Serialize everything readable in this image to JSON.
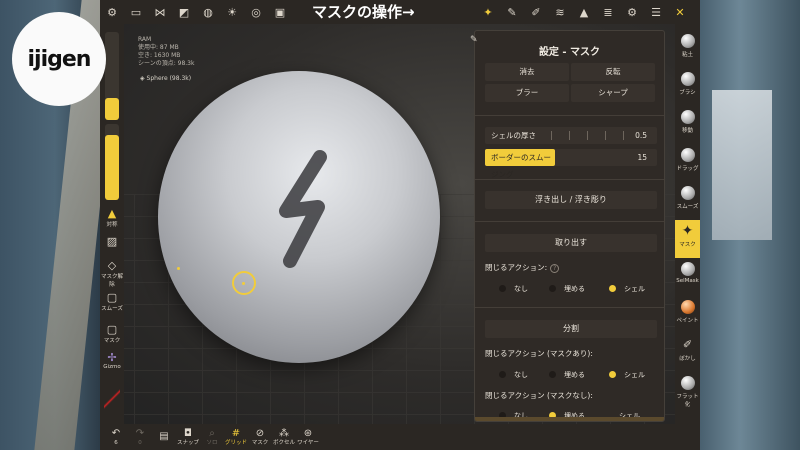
{
  "overlay": {
    "logo_text": "ijigen",
    "title": "マスクの操作→"
  },
  "viewport": {
    "stats": [
      "RAM",
      "使用中: 87 MB",
      "空き: 1630 MB",
      "シーンの頂点: 98.3k"
    ],
    "object_tag": "Sphere (98.3k)"
  },
  "top_toolbar": {
    "left_icons": [
      "scene-icon",
      "folder-icon",
      "share-icon",
      "shapes-icon",
      "globe-icon",
      "sun-icon",
      "material-icon",
      "image-icon"
    ],
    "right_icons": [
      "mask-tool-icon",
      "pen-icon",
      "paint-icon",
      "stroke-icon",
      "triangle-icon",
      "layers-icon",
      "settings-icon",
      "sliders-icon",
      "tools-icon"
    ]
  },
  "left_rail": {
    "tools": [
      {
        "label": "対称",
        "icon": "symmetry-icon"
      },
      {
        "label": "",
        "icon": "image-tool-icon"
      },
      {
        "label": "マスク解除",
        "icon": "eraser-icon"
      },
      {
        "label": "スムーズ",
        "icon": "smooth-icon"
      },
      {
        "label": "マスク",
        "icon": "mask-icon"
      },
      {
        "label": "Gizmo",
        "icon": "gizmo-icon"
      }
    ],
    "size_slider": 0.25,
    "intensity_slider": 0.85
  },
  "bottom_bar": {
    "items": [
      {
        "label": "6",
        "icon": "undo-icon",
        "state": "normal"
      },
      {
        "label": "0",
        "icon": "redo-icon",
        "state": "dim"
      },
      {
        "label": "",
        "icon": "stack-icon",
        "state": "normal"
      },
      {
        "label": "スナップ",
        "icon": "camera-icon",
        "state": "normal"
      },
      {
        "label": "ソロ",
        "icon": "search-icon",
        "state": "dim"
      },
      {
        "label": "グリッド",
        "icon": "grid-icon",
        "state": "active"
      },
      {
        "label": "マスク",
        "icon": "eye-off-icon",
        "state": "normal"
      },
      {
        "label": "ボクセル",
        "icon": "voxel-icon",
        "state": "normal"
      },
      {
        "label": "ワイヤー",
        "icon": "wire-icon",
        "state": "normal"
      }
    ]
  },
  "right_rail": {
    "tools": [
      {
        "label": "粘土",
        "active": false
      },
      {
        "label": "ブラシ",
        "active": false
      },
      {
        "label": "移動",
        "active": false
      },
      {
        "label": "ドラッグ",
        "active": false
      },
      {
        "label": "スムーズ",
        "active": false
      },
      {
        "label": "マスク",
        "active": true
      },
      {
        "label": "SelMask",
        "active": false
      },
      {
        "label": "ペイント",
        "active": false
      },
      {
        "label": "ぼかし",
        "active": false
      },
      {
        "label": "フラット化",
        "active": false
      }
    ]
  },
  "panel": {
    "title": "設定 - マスク",
    "buttons": [
      "消去",
      "反転",
      "ブラー",
      "シャープ"
    ],
    "shell_thickness": {
      "label": "シェルの厚さ",
      "value": "0.5"
    },
    "border_smoothing": {
      "label": "ボーダーのスムージング",
      "value": "15"
    },
    "extrude_button": "浮き出し / 浮き彫り",
    "extract_button": "取り出す",
    "close_action_label": "閉じるアクション:",
    "close_action_options": [
      "なし",
      "埋める",
      "シェル"
    ],
    "close_action_selected": "シェル",
    "split_button": "分割",
    "split_close_masked_label": "閉じるアクション (マスクあり):",
    "split_close_masked_options": [
      "なし",
      "埋める",
      "シェル"
    ],
    "split_close_masked_selected": "シェル",
    "split_close_unmasked_label": "閉じるアクション (マスクなし):",
    "split_close_unmasked_options": [
      "なし",
      "埋める",
      "シェル"
    ],
    "split_close_unmasked_selected": "埋める"
  },
  "colors": {
    "accent": "#f1cc3b",
    "panel_bg": "#2f2a26",
    "toolbar_bg": "#2b2723"
  }
}
